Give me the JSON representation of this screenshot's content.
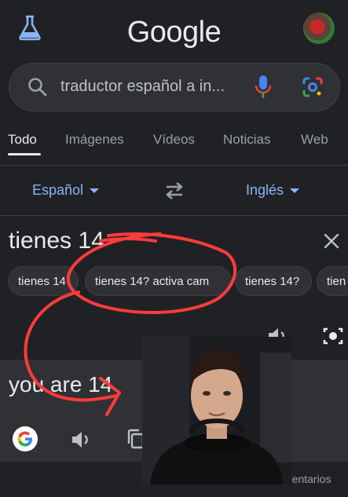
{
  "header": {
    "logo_text": "Google",
    "labs_icon": "flask-icon",
    "avatar_icon": "avatar"
  },
  "search": {
    "query": "traductor español a in...",
    "search_icon": "search-icon",
    "mic_icon": "mic-icon",
    "lens_icon": "lens-icon"
  },
  "tabs": [
    {
      "label": "Todo",
      "active": true
    },
    {
      "label": "Imágenes"
    },
    {
      "label": "Vídeos"
    },
    {
      "label": "Noticias"
    },
    {
      "label": "Web"
    }
  ],
  "translator": {
    "source_lang": "Español",
    "target_lang": "Inglés",
    "source_text": "tienes 14",
    "chips": [
      "tienes 14",
      "tienes 14? activa cam",
      "tienes 14?",
      "tien"
    ],
    "output_text": "you are 14",
    "feedback_label": "mentarios"
  },
  "colors": {
    "background": "#202124",
    "link_blue": "#8ab4f8",
    "annotation_red": "#ff3b3b"
  }
}
